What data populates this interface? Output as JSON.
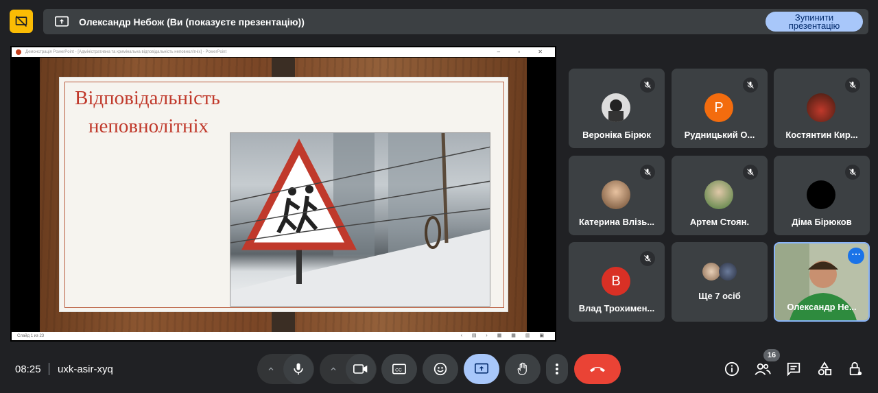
{
  "banner": {
    "presenter_text": "Олександр Небож (Ви (показуєте презентацію))",
    "stop_button": "Зупинити презентацію"
  },
  "presentation": {
    "window_title": "Демонстрація PowerPoint - [Адміністративна та кримінальна відповідальність неповнолітніх] - PowerPoint",
    "slide_title_line1": "Відповідальність",
    "slide_title_line2": "неповнолітніх",
    "status_text": "Слайд 1 из 23"
  },
  "participants": [
    {
      "name": "Вероніка Бірюк",
      "muted": true,
      "avatar": "photo"
    },
    {
      "name": "Рудницький О...",
      "muted": true,
      "avatar": "letter",
      "letter": "Р",
      "color": "#f36c0e"
    },
    {
      "name": "Костянтин Кир...",
      "muted": true,
      "avatar": "photo"
    },
    {
      "name": "Катерина Влізь...",
      "muted": true,
      "avatar": "photo"
    },
    {
      "name": "Артем Стоян.",
      "muted": true,
      "avatar": "photo"
    },
    {
      "name": "Діма Бірюков",
      "muted": true,
      "avatar": "black"
    },
    {
      "name": "Влад Трохимен...",
      "muted": true,
      "avatar": "letter",
      "letter": "В",
      "color": "#d93025"
    },
    {
      "name": "Ще 7 осіб",
      "muted": false,
      "avatar": "group"
    },
    {
      "name": "Олександр Не...",
      "muted": false,
      "avatar": "self"
    }
  ],
  "meeting": {
    "time": "08:25",
    "code": "uxk-asir-xyq",
    "people_count": "16"
  },
  "colors": {
    "accent": "#a8c7fa",
    "end_call": "#ea4335",
    "banner_icon": "#fbbc04"
  }
}
